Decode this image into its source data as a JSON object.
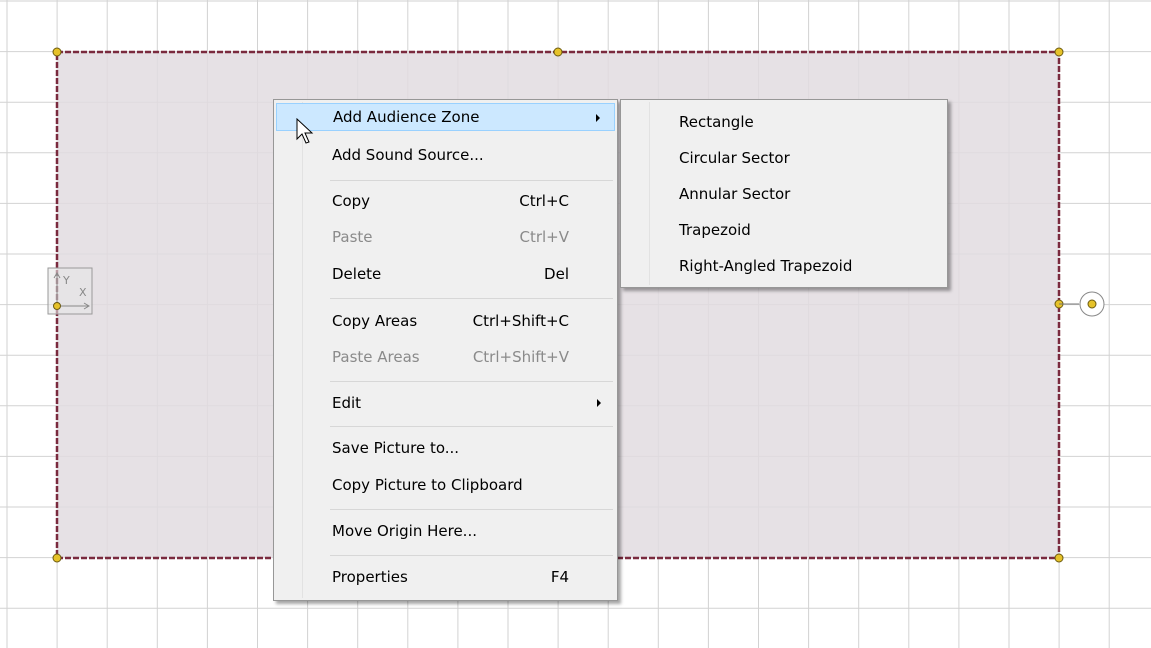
{
  "context_menu": {
    "add_audience_zone": "Add Audience Zone",
    "add_sound_source": "Add Sound Source...",
    "copy": "Copy",
    "copy_shortcut": "Ctrl+C",
    "paste": "Paste",
    "paste_shortcut": "Ctrl+V",
    "delete": "Delete",
    "delete_shortcut": "Del",
    "copy_areas": "Copy Areas",
    "copy_areas_shortcut": "Ctrl+Shift+C",
    "paste_areas": "Paste Areas",
    "paste_areas_shortcut": "Ctrl+Shift+V",
    "edit": "Edit",
    "save_picture": "Save Picture to...",
    "copy_picture": "Copy Picture to Clipboard",
    "move_origin": "Move Origin Here...",
    "properties": "Properties",
    "properties_shortcut": "F4"
  },
  "submenu": {
    "rectangle": "Rectangle",
    "circular_sector": "Circular Sector",
    "annular_sector": "Annular Sector",
    "trapezoid": "Trapezoid",
    "right_angled_trapezoid": "Right-Angled Trapezoid"
  },
  "axis": {
    "y_label": "Y",
    "x_label": "X"
  },
  "colors": {
    "grid": "#d2d2d2",
    "zone_fill": "#e2dce0",
    "zone_border": "#7a2a3e",
    "handle": "#e6c229",
    "highlight": "#cce8ff"
  }
}
